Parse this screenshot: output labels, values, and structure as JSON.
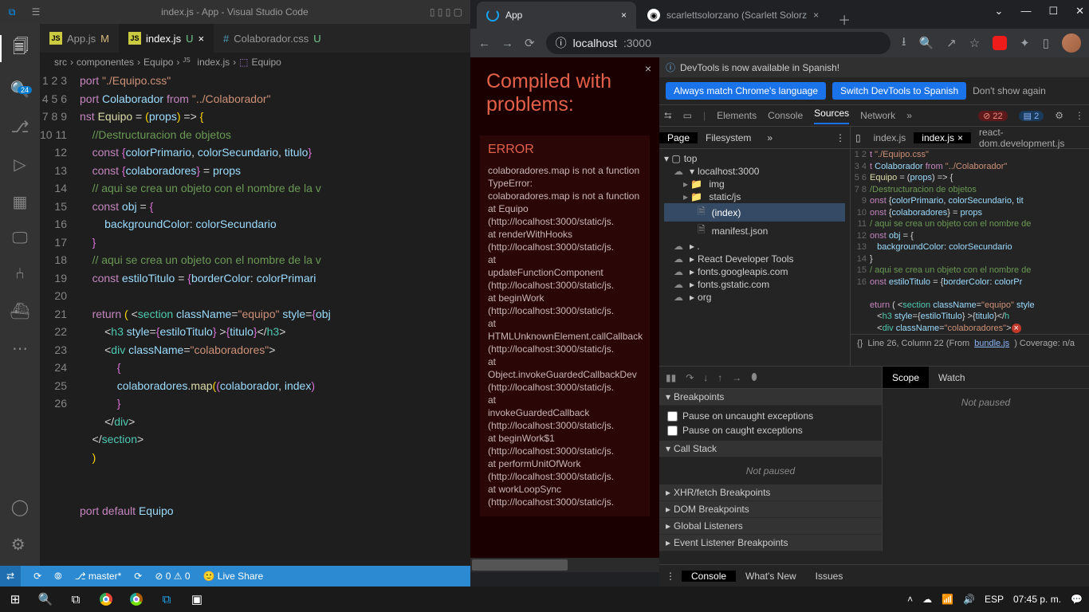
{
  "vscode": {
    "title": "index.js - App - Visual Studio Code",
    "tabs": [
      {
        "label": "App.js",
        "mark": "M"
      },
      {
        "label": "index.js",
        "mark": "U"
      },
      {
        "label": "Colaborador.css",
        "mark": "U"
      }
    ],
    "breadcrumb": [
      "src",
      "componentes",
      "Equipo",
      "index.js",
      "Equipo"
    ],
    "activity_badge": "24",
    "status": {
      "branch": "master*",
      "errors": "0",
      "warnings": "0",
      "liveshare": "Live Share"
    }
  },
  "chrome": {
    "tabs": [
      {
        "label": "App"
      },
      {
        "label": "scarlettsolorzano (Scarlett Solorz"
      }
    ],
    "url_host": "localhost",
    "url_port": ":3000"
  },
  "overlay": {
    "title": "Compiled with problems:",
    "error_label": "ERROR",
    "lines": [
      "colaboradores.map is not a function",
      "TypeError:",
      "colaboradores.map is not a function",
      "    at Equipo",
      "(http://localhost:3000/static/js.",
      "    at renderWithHooks",
      "(http://localhost:3000/static/js.",
      "    at",
      "updateFunctionComponent",
      "(http://localhost:3000/static/js.",
      "    at beginWork",
      "(http://localhost:3000/static/js.",
      "    at",
      "HTMLUnknownElement.callCallback",
      "(http://localhost:3000/static/js.",
      "    at",
      "Object.invokeGuardedCallbackDev",
      "(http://localhost:3000/static/js.",
      "    at",
      "invokeGuardedCallback",
      "(http://localhost:3000/static/js.",
      "    at beginWork$1",
      "(http://localhost:3000/static/js.",
      "    at performUnitOfWork",
      "(http://localhost:3000/static/js.",
      "    at workLoopSync",
      "(http://localhost:3000/static/js."
    ]
  },
  "devtools": {
    "banner": "DevTools is now available in Spanish!",
    "btn1": "Always match Chrome's language",
    "btn2": "Switch DevTools to Spanish",
    "btn3": "Don't show again",
    "panels": [
      "Elements",
      "Console",
      "Sources",
      "Network"
    ],
    "err_count": "22",
    "warn_count": "2",
    "left_tabs": [
      "Page",
      "Filesystem"
    ],
    "tree": {
      "top": "top",
      "host": "localhost:3000",
      "img": "img",
      "static": "static/js",
      "index": "(index)",
      "manifest": "manifest.json",
      "rdt": "React Developer Tools",
      "fga": "fonts.googleapis.com",
      "fgs": "fonts.gstatic.com",
      "org": "org"
    },
    "src_tabs": [
      "index.js",
      "index.js",
      "react-dom.development.js"
    ],
    "status_line": "Line 26, Column 22  (From ",
    "status_link": "bundle.js",
    "status_cov": ")  Coverage: n/a",
    "breakpoints_hdr": "Breakpoints",
    "pause_uncaught": "Pause on uncaught exceptions",
    "pause_caught": "Pause on caught exceptions",
    "callstack": "Call Stack",
    "notpaused": "Not paused",
    "xhr": "XHR/fetch Breakpoints",
    "dom": "DOM Breakpoints",
    "gl": "Global Listeners",
    "elb": "Event Listener Breakpoints",
    "scope": "Scope",
    "watch": "Watch",
    "drawer": [
      "Console",
      "What's New",
      "Issues"
    ]
  },
  "taskbar": {
    "lang": "ESP",
    "time": "07:45 p. m."
  }
}
